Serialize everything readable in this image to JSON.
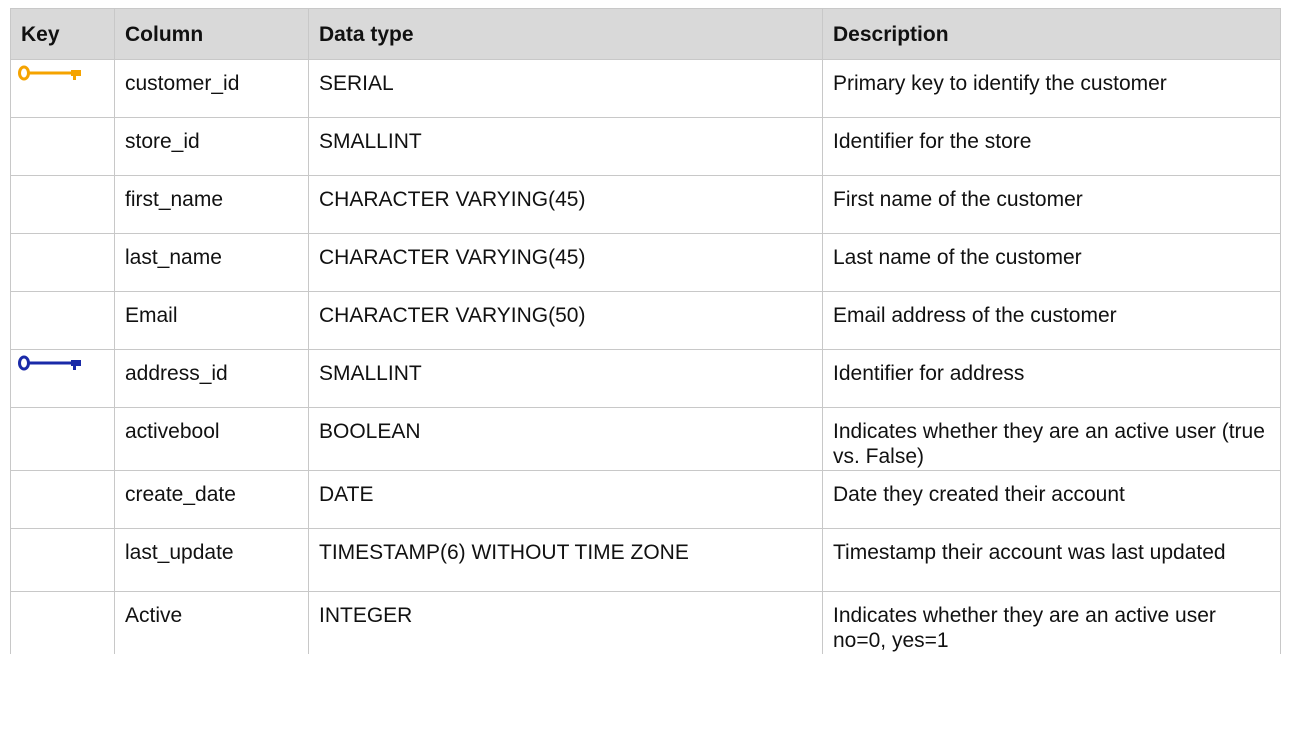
{
  "header": {
    "key": "Key",
    "column": "Column",
    "data_type": "Data type",
    "description": "Description"
  },
  "rows": [
    {
      "key": "primary",
      "key_color": "#f5a300",
      "column": "customer_id",
      "data_type": "SERIAL",
      "description": "Primary key to identify the customer"
    },
    {
      "key": "",
      "column": "store_id",
      "data_type": "SMALLINT",
      "description": "Identifier for the store"
    },
    {
      "key": "",
      "column": "first_name",
      "data_type": "CHARACTER VARYING(45)",
      "description": "First name of the customer"
    },
    {
      "key": "",
      "column": "last_name",
      "data_type": "CHARACTER VARYING(45)",
      "description": "Last name of the customer"
    },
    {
      "key": "",
      "column": "Email",
      "data_type": "CHARACTER VARYING(50)",
      "description": "Email address of the customer"
    },
    {
      "key": "foreign",
      "key_color": "#1a2aa8",
      "column": "address_id",
      "data_type": "SMALLINT",
      "description": "Identifier for address"
    },
    {
      "key": "",
      "column": "activebool",
      "data_type": "BOOLEAN",
      "description": "Indicates whether they are an active user (true vs. False)"
    },
    {
      "key": "",
      "column": "create_date",
      "data_type": "DATE",
      "description": "Date they created their account"
    },
    {
      "key": "",
      "column": "last_update",
      "data_type": "TIMESTAMP(6) WITHOUT TIME ZONE",
      "description": "Timestamp their account was last updated"
    },
    {
      "key": "",
      "column": "Active",
      "data_type": "INTEGER",
      "description": "Indicates whether they are an active user no=0, yes=1"
    }
  ],
  "colors": {
    "header_bg": "#d9d9d9",
    "border": "#c8c8c8",
    "primary_key": "#f5a300",
    "foreign_key": "#1a2aa8"
  }
}
